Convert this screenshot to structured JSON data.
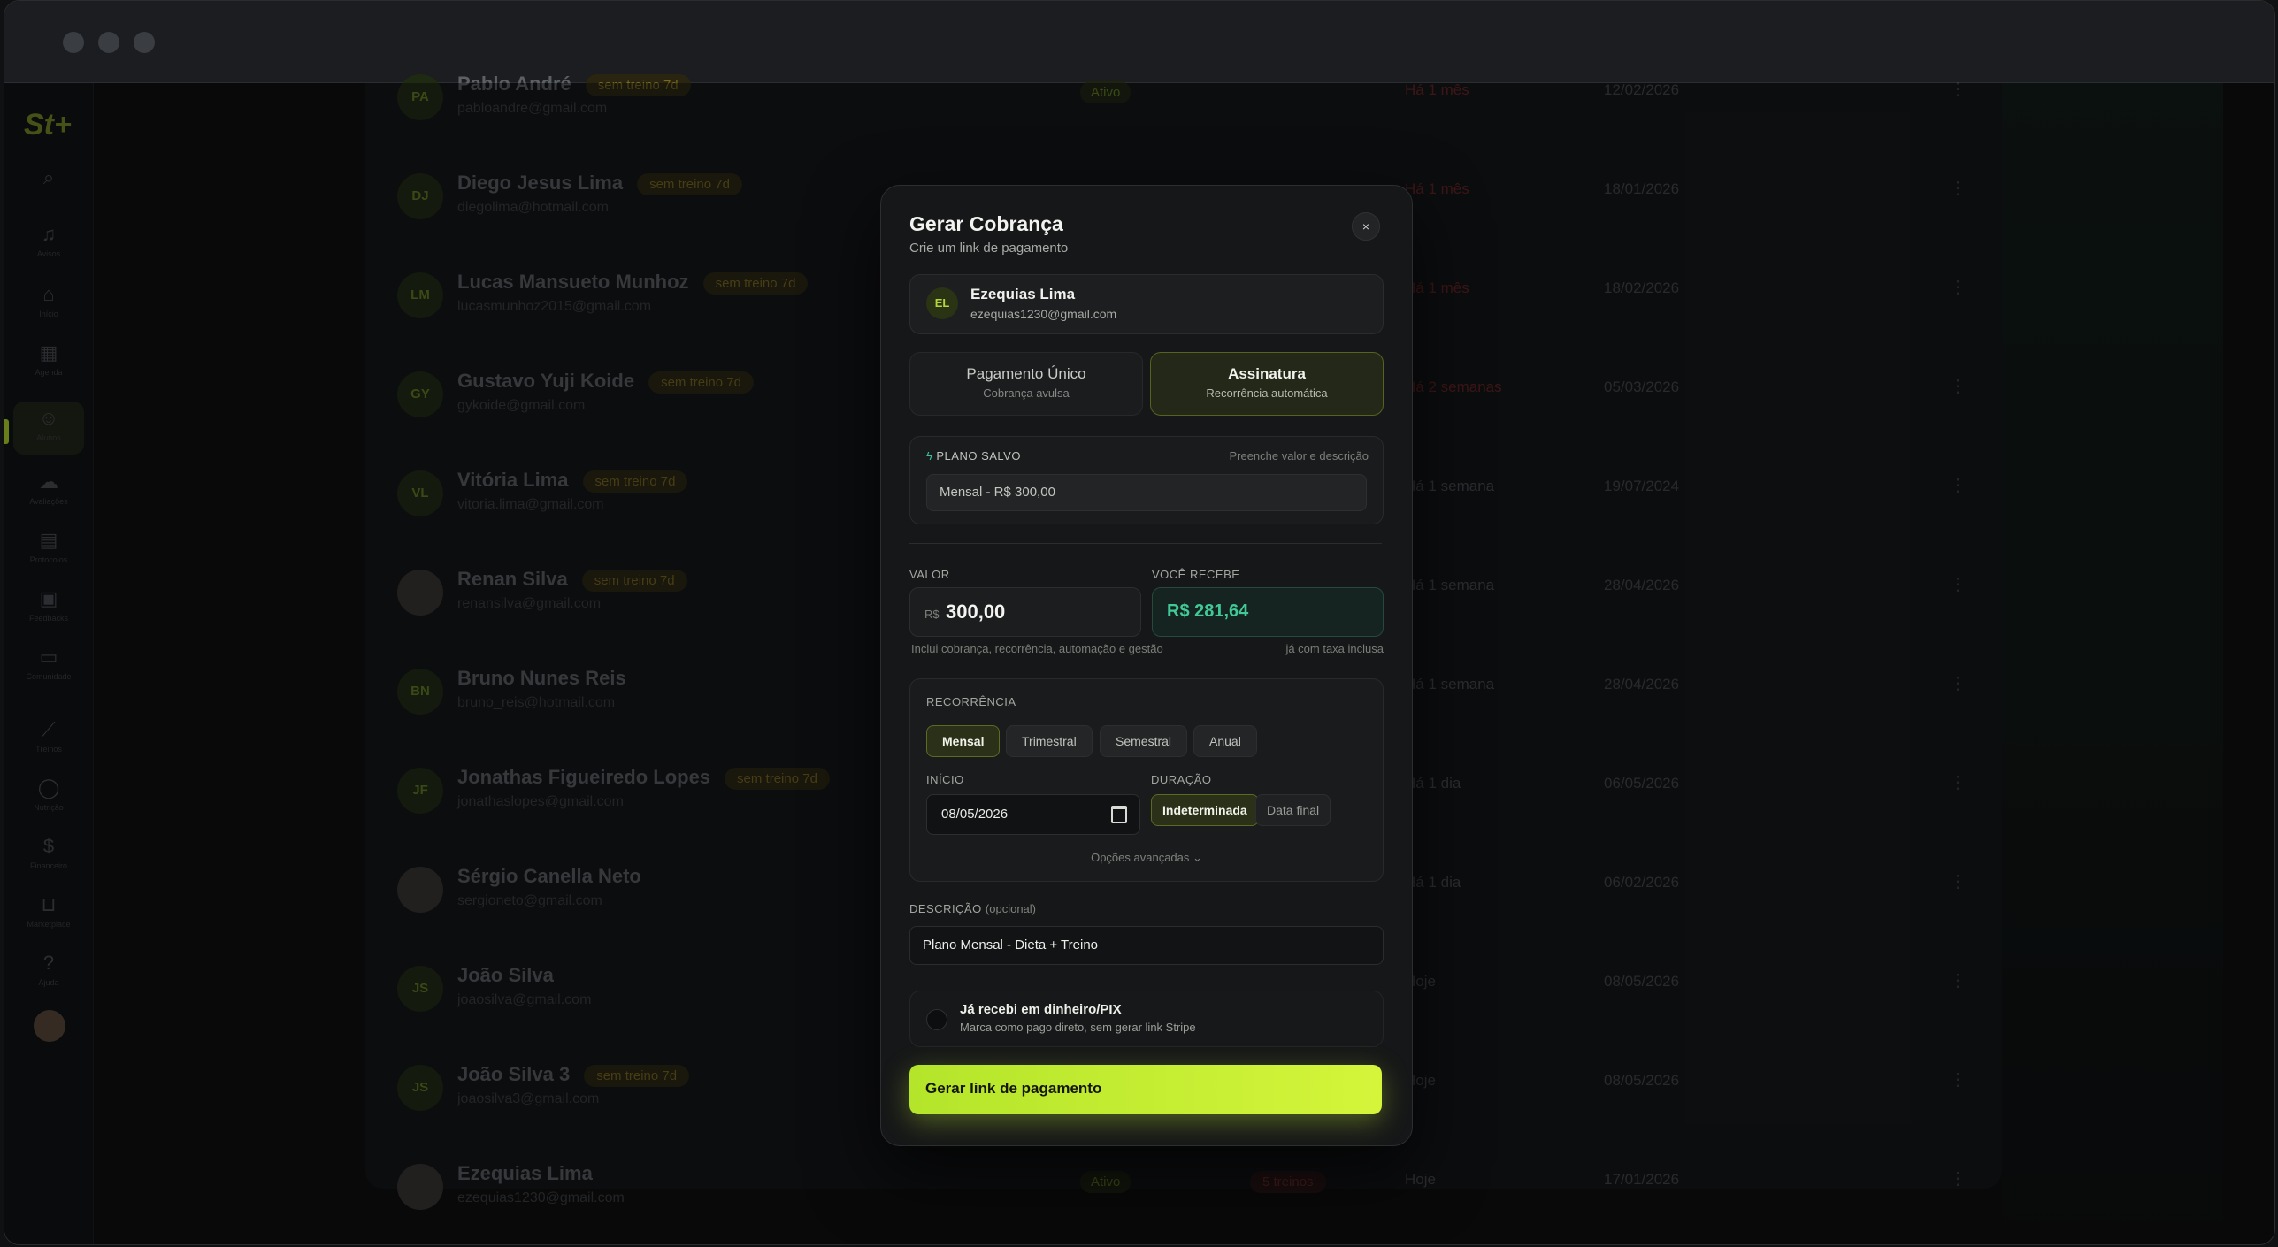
{
  "sidebar": {
    "logo": "St+",
    "items": [
      {
        "icon": "search-icon",
        "label": ""
      },
      {
        "icon": "bell-icon",
        "label": "Avisos"
      },
      {
        "icon": "home-icon",
        "label": "Início"
      },
      {
        "icon": "calendar-icon",
        "label": "Agenda"
      },
      {
        "icon": "users-icon",
        "label": "Alunos"
      },
      {
        "icon": "upload-icon",
        "label": "Avaliações"
      },
      {
        "icon": "document-icon",
        "label": "Protocolos"
      },
      {
        "icon": "clipboard-icon",
        "label": "Feedbacks"
      },
      {
        "icon": "chat-icon",
        "label": "Comunidade"
      },
      {
        "icon": "dumbbell-icon",
        "label": "Treinos"
      },
      {
        "icon": "apple-icon",
        "label": "Nutrição"
      },
      {
        "icon": "dollar-icon",
        "label": "Financeiro"
      },
      {
        "icon": "cart-icon",
        "label": "Marketplace"
      },
      {
        "icon": "help-icon",
        "label": "Ajuda"
      }
    ]
  },
  "students": [
    {
      "initials": "PA",
      "name": "Pablo André",
      "email": "pabloandre@gmail.com",
      "chip": "sem treino 7d",
      "status": "Ativo",
      "badge": "",
      "last": "Há 1 mês",
      "last_red": true,
      "date": "12/02/2026"
    },
    {
      "initials": "DJ",
      "name": "Diego Jesus Lima",
      "email": "diegolima@hotmail.com",
      "chip": "sem treino 7d",
      "status": "",
      "badge": "",
      "last": "Há 1 mês",
      "last_red": true,
      "date": "18/01/2026"
    },
    {
      "initials": "LM",
      "name": "Lucas Mansueto Munhoz",
      "email": "lucasmunhoz2015@gmail.com",
      "chip": "sem treino 7d",
      "status": "",
      "badge": "",
      "last": "Há 1 mês",
      "last_red": true,
      "date": "18/02/2026"
    },
    {
      "initials": "GY",
      "name": "Gustavo Yuji Koide",
      "email": "gykoide@gmail.com",
      "chip": "sem treino 7d",
      "status": "",
      "badge": "",
      "last": "Há 2 semanas",
      "last_red": true,
      "date": "05/03/2026"
    },
    {
      "initials": "VL",
      "name": "Vitória Lima",
      "email": "vitoria.lima@gmail.com",
      "chip": "sem treino 7d",
      "status": "",
      "badge": "",
      "last": "Há 1 semana",
      "last_red": false,
      "date": "19/07/2024"
    },
    {
      "initials": "",
      "name": "Renan Silva",
      "email": "renansilva@gmail.com",
      "chip": "sem treino 7d",
      "status": "",
      "badge": "",
      "last": "Há 1 semana",
      "last_red": false,
      "date": "28/04/2026"
    },
    {
      "initials": "BN",
      "name": "Bruno Nunes Reis",
      "email": "bruno_reis@hotmail.com",
      "chip": "",
      "status": "",
      "badge": "",
      "last": "Há 1 semana",
      "last_red": false,
      "date": "28/04/2026"
    },
    {
      "initials": "JF",
      "name": "Jonathas Figueiredo Lopes",
      "email": "jonathaslopes@gmail.com",
      "chip": "sem treino 7d",
      "status": "",
      "badge": "",
      "last": "Há 1 dia",
      "last_red": false,
      "date": "06/05/2026"
    },
    {
      "initials": "",
      "name": "Sérgio Canella Neto",
      "email": "sergioneto@gmail.com",
      "chip": "",
      "status": "",
      "badge": "",
      "last": "Há 1 dia",
      "last_red": false,
      "date": "06/02/2026"
    },
    {
      "initials": "JS",
      "name": "João Silva",
      "email": "joaosilva@gmail.com",
      "chip": "",
      "status": "",
      "badge": "",
      "last": "Hoje",
      "last_red": false,
      "date": "08/05/2026"
    },
    {
      "initials": "JS",
      "name": "João Silva 3",
      "email": "joaosilva3@gmail.com",
      "chip": "sem treino 7d",
      "status": "",
      "badge": "",
      "last": "Hoje",
      "last_red": false,
      "date": "08/05/2026"
    },
    {
      "initials": "",
      "name": "Ezequias Lima",
      "email": "ezequias1230@gmail.com",
      "chip": "",
      "status": "Ativo",
      "badge": "5 treinos",
      "last": "Hoje",
      "last_red": false,
      "date": "17/01/2026"
    }
  ],
  "modal": {
    "title": "Gerar Cobrança",
    "subtitle": "Crie um link de pagamento",
    "close_label": "×",
    "client": {
      "initials": "EL",
      "name": "Ezequias Lima",
      "email": "ezequias1230@gmail.com"
    },
    "payment_types": [
      {
        "title": "Pagamento Único",
        "subtitle": "Cobrança avulsa",
        "selected": false
      },
      {
        "title": "Assinatura",
        "subtitle": "Recorrência automática",
        "selected": true
      }
    ],
    "saved_plan": {
      "label": "PLANO SALVO",
      "hint": "Preenche valor e descrição",
      "value": "Mensal - R$ 300,00"
    },
    "valor": {
      "label": "VALOR",
      "currency": "R$",
      "value": "300,00",
      "hint": "Inclui cobrança, recorrência, automação e gestão"
    },
    "recebe": {
      "label": "VOCÊ RECEBE",
      "value": "R$ 281,64",
      "hint": "já com taxa inclusa"
    },
    "recorrencia": {
      "label": "RECORRÊNCIA",
      "options": [
        "Mensal",
        "Trimestral",
        "Semestral",
        "Anual"
      ],
      "selected": "Mensal",
      "inicio_label": "INÍCIO",
      "inicio_value": "08/05/2026",
      "duracao_label": "DURAÇÃO",
      "duracao_options": [
        "Indeterminada",
        "Data final"
      ],
      "duracao_selected": "Indeterminada",
      "advanced": "Opções avançadas ⌄"
    },
    "descricao": {
      "label": "DESCRIÇÃO",
      "optional": "(opcional)",
      "value": "Plano Mensal - Dieta + Treino"
    },
    "cash": {
      "title": "Já recebi em dinheiro/PIX",
      "subtitle": "Marca como pago direto, sem gerar link Stripe",
      "checked": false
    },
    "cta_label": "Gerar link de pagamento"
  },
  "colors": {
    "accent": "#c4ee30",
    "success": "#41c997",
    "danger": "#7a2c2c"
  }
}
